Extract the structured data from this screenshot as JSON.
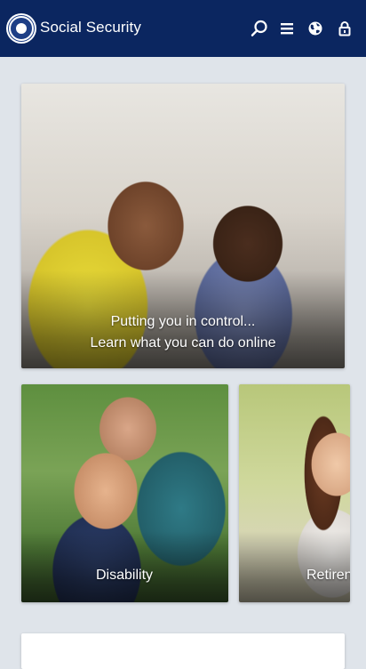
{
  "header": {
    "brand": "Social Security",
    "icons": [
      "seal-logo",
      "search-icon",
      "menu-icon",
      "globe-icon",
      "lock-icon"
    ],
    "background_color": "#0b2660"
  },
  "hero": {
    "line1": "Putting you in control...",
    "line2": "Learn what you can do online"
  },
  "tiles": [
    {
      "label": "Disability"
    },
    {
      "label": "Retiren"
    }
  ]
}
